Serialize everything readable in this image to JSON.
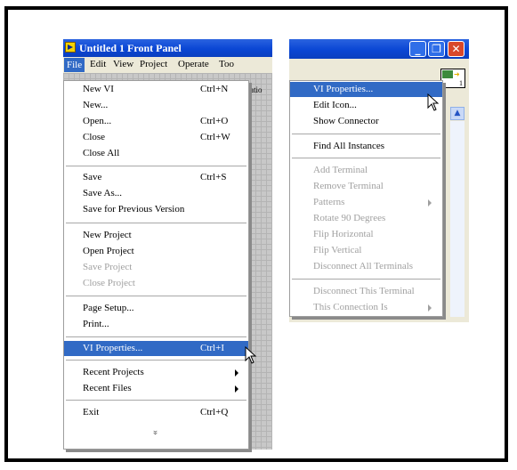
{
  "left_window": {
    "title": "Untitled 1 Front Panel",
    "menubar": [
      "File",
      "Edit",
      "View",
      "Project",
      "Operate",
      "Too"
    ],
    "partial_toolbar_text": "atio",
    "file_menu": {
      "items": [
        {
          "label": "New VI",
          "shortcut": "Ctrl+N"
        },
        {
          "label": "New...",
          "shortcut": ""
        },
        {
          "label": "Open...",
          "shortcut": "Ctrl+O"
        },
        {
          "label": "Close",
          "shortcut": "Ctrl+W"
        },
        {
          "label": "Close All",
          "shortcut": ""
        },
        {
          "label": "Save",
          "shortcut": "Ctrl+S"
        },
        {
          "label": "Save As...",
          "shortcut": ""
        },
        {
          "label": "Save for Previous Version",
          "shortcut": ""
        },
        {
          "label": "New Project",
          "shortcut": ""
        },
        {
          "label": "Open Project",
          "shortcut": ""
        },
        {
          "label": "Save Project",
          "shortcut": "",
          "disabled": true
        },
        {
          "label": "Close Project",
          "shortcut": "",
          "disabled": true
        },
        {
          "label": "Page Setup...",
          "shortcut": ""
        },
        {
          "label": "Print...",
          "shortcut": ""
        },
        {
          "label": "VI Properties...",
          "shortcut": "Ctrl+I",
          "selected": true
        },
        {
          "label": "Recent Projects",
          "shortcut": "",
          "submenu": true
        },
        {
          "label": "Recent Files",
          "shortcut": "",
          "submenu": true
        },
        {
          "label": "Exit",
          "shortcut": "Ctrl+Q"
        }
      ],
      "more_glyph": "»"
    }
  },
  "right_window": {
    "connector_number": "1",
    "context_menu": {
      "items": [
        {
          "label": "VI Properties...",
          "selected": true
        },
        {
          "label": "Edit Icon..."
        },
        {
          "label": "Show Connector"
        },
        {
          "label": "Find All Instances"
        },
        {
          "label": "Add Terminal",
          "disabled": true
        },
        {
          "label": "Remove Terminal",
          "disabled": true
        },
        {
          "label": "Patterns",
          "disabled": true,
          "submenu": true
        },
        {
          "label": "Rotate 90 Degrees",
          "disabled": true
        },
        {
          "label": "Flip Horizontal",
          "disabled": true
        },
        {
          "label": "Flip Vertical",
          "disabled": true
        },
        {
          "label": "Disconnect All Terminals",
          "disabled": true
        },
        {
          "label": "Disconnect This Terminal",
          "disabled": true
        },
        {
          "label": "This Connection Is",
          "disabled": true,
          "submenu": true
        }
      ]
    }
  },
  "colors": {
    "selection": "#316ac5",
    "titlebar": "#0a46d4",
    "disabled_text": "#a0a0a0"
  }
}
